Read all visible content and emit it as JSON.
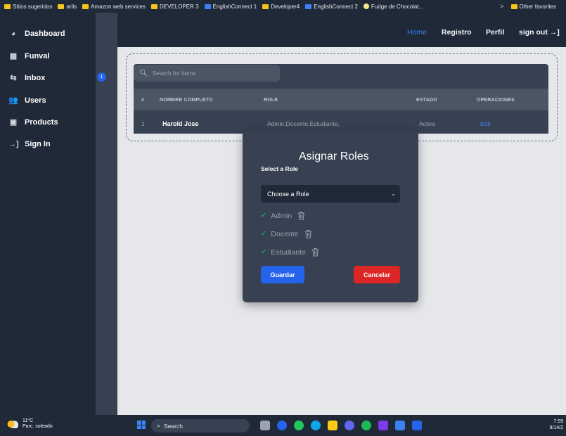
{
  "bookmarks": {
    "items": [
      "Sitios sugeridos",
      "arlis",
      "Amazon web services",
      "DEVELOPER 3",
      "EnglishConnect 1",
      "Developer4",
      "EnglishConnect 2",
      "Fudge de Chocolat..."
    ],
    "other": "Other favorites"
  },
  "sidebar": {
    "items": [
      {
        "label": "Dashboard",
        "icon": "pie-chart-icon"
      },
      {
        "label": "Funval",
        "icon": "grid-icon"
      },
      {
        "label": "Inbox",
        "icon": "inbox-icon"
      },
      {
        "label": "Users",
        "icon": "users-icon"
      },
      {
        "label": "Products",
        "icon": "bag-icon"
      },
      {
        "label": "Sign In",
        "icon": "sign-in-icon"
      }
    ],
    "inbox_badge": "1"
  },
  "topnav": {
    "home": "Home",
    "registro": "Registro",
    "perfil": "Perfil",
    "signout": "sign out"
  },
  "search": {
    "placeholder": "Search for items"
  },
  "table": {
    "headers": [
      "#",
      "NOMBRE COMPLETO",
      "ROLE",
      "ESTADO",
      "OPERACIONES"
    ],
    "rows": [
      {
        "num": "1",
        "name": "Harold Jose",
        "role": "Admin,Docente,Estudiante,",
        "status": "Active",
        "op": "Edit"
      }
    ]
  },
  "modal": {
    "title": "Asignar Roles",
    "subtitle": "Select a Role",
    "select_value": "Choose a Role",
    "roles": [
      "Admin",
      "Docente",
      "Estudiante"
    ],
    "save": "Guardar",
    "cancel": "Cancelar"
  },
  "taskbar": {
    "temp": "11°C",
    "weather": "Parc. soleado",
    "search": "Search",
    "time": "7:59",
    "date": "9/14/2"
  },
  "colors": {
    "accent": "#2563eb",
    "danger": "#dc2626",
    "success": "#22c55e",
    "sidebar": "#1f2937",
    "panel": "#374151"
  }
}
